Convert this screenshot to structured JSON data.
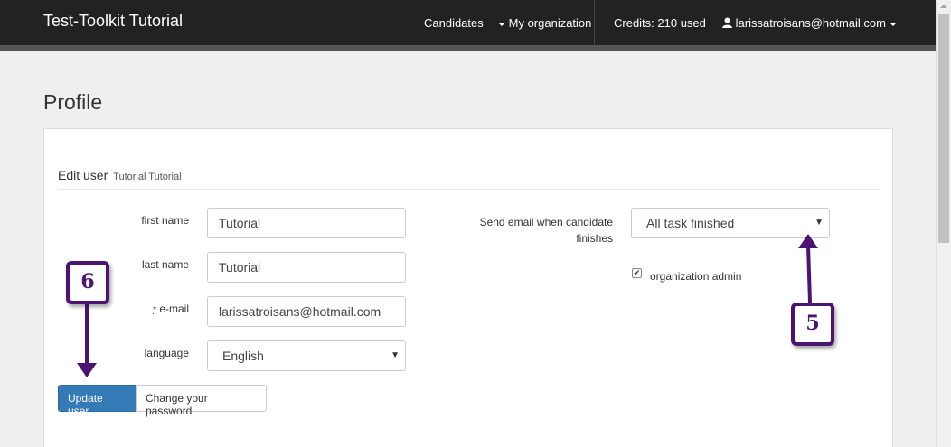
{
  "navbar": {
    "brand": "Test-Toolkit Tutorial",
    "candidates": "Candidates",
    "my_organization": "My organization",
    "credits": "Credits: 210 used",
    "user_email": "larissatroisans@hotmail.com"
  },
  "page": {
    "title": "Profile"
  },
  "form": {
    "heading": "Edit user",
    "heading_sub": "Tutorial Tutorial",
    "first_name_label": "first name",
    "first_name_value": "Tutorial",
    "last_name_label": "last name",
    "last_name_value": "Tutorial",
    "email_required_mark": "*",
    "email_label": "e-mail",
    "email_value": "larissatroisans@hotmail.com",
    "language_label": "language",
    "language_value": "English",
    "send_email_label_1": "Send email when candidate",
    "send_email_label_2": "finishes",
    "send_email_value": "All task finished",
    "org_admin_label": "organization admin",
    "org_admin_checked": true
  },
  "buttons": {
    "update": "Update user",
    "change_password": "Change your password"
  },
  "callouts": {
    "six": "6",
    "five": "5",
    "accent_color": "#4b1472"
  },
  "colors": {
    "navbar": "#222222",
    "primary": "#337ab7"
  }
}
